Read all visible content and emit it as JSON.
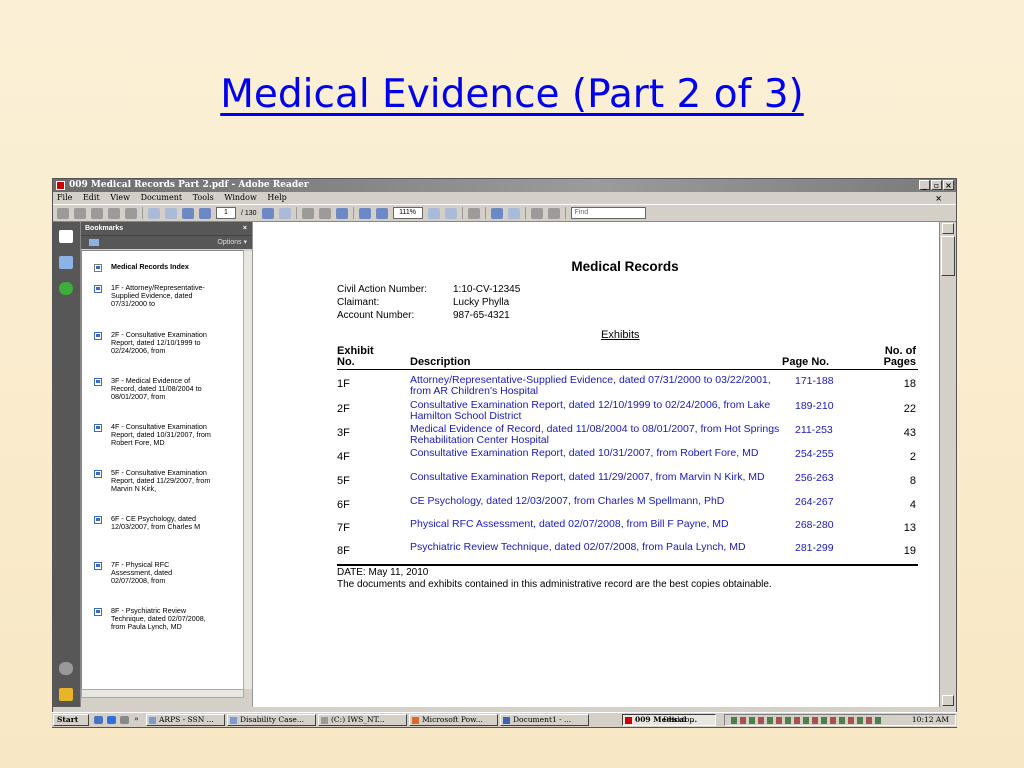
{
  "slide": {
    "title": "Medical Evidence (Part 2 of 3)"
  },
  "window": {
    "title": "009 Medical Records Part 2.pdf - Adobe Reader",
    "menu": [
      "File",
      "Edit",
      "View",
      "Document",
      "Tools",
      "Window",
      "Help"
    ],
    "close_glyph": "×",
    "toolbar": {
      "page_current": "1",
      "page_total": "/ 130",
      "zoom": "111%",
      "find_placeholder": "Find"
    }
  },
  "bookmarks": {
    "header": "Bookmarks",
    "close_glyph": "×",
    "options_label": "Options ▾",
    "items": [
      {
        "label": "Medical Records Index",
        "bold": true
      },
      {
        "label": "1F - Attorney/Representative-Supplied Evidence, dated 07/31/2000 to"
      },
      {
        "label": "2F - Consultative Examination Report, dated 12/10/1999 to 02/24/2006, from"
      },
      {
        "label": "3F - Medical Evidence of Record, dated 11/08/2004 to 08/01/2007, from"
      },
      {
        "label": "4F - Consultative Examination Report, dated 10/31/2007, from Robert Fore, MD"
      },
      {
        "label": "5F - Consultative Examination Report, dated 11/29/2007, from Marvin N Kirk,"
      },
      {
        "label": "6F - CE Psychology, dated 12/03/2007, from Charles M"
      },
      {
        "label": "7F - Physical RFC Assessment, dated 02/07/2008, from"
      },
      {
        "label": "8F - Psychiatric Review Technique, dated 02/07/2008, from Paula Lynch, MD"
      }
    ]
  },
  "document": {
    "title": "Medical Records",
    "meta": [
      {
        "label": "Civil Action Number:",
        "value": "1:10-CV-12345"
      },
      {
        "label": "Claimant:",
        "value": "Lucky Phylla"
      },
      {
        "label": "Account Number:",
        "value": "987-65-4321"
      }
    ],
    "exhibits_heading": "Exhibits",
    "columns": {
      "exhibit_no_1": "Exhibit",
      "exhibit_no_2": "No.",
      "description": "Description",
      "page_no": "Page No.",
      "num_pages_1": "No. of",
      "num_pages_2": "Pages"
    },
    "rows": [
      {
        "no": "1F",
        "desc": "Attorney/Representative-Supplied Evidence, dated 07/31/2000 to 03/22/2001, from AR Children's Hospital",
        "pages": "171-188",
        "count": "18"
      },
      {
        "no": "2F",
        "desc": "Consultative Examination Report, dated 12/10/1999 to 02/24/2006, from Lake Hamilton School District",
        "pages": "189-210",
        "count": "22"
      },
      {
        "no": "3F",
        "desc": "Medical Evidence of Record, dated 11/08/2004 to 08/01/2007, from Hot Springs Rehabilitation Center Hospital",
        "pages": "211-253",
        "count": "43"
      },
      {
        "no": "4F",
        "desc": "Consultative Examination Report, dated 10/31/2007, from Robert Fore, MD",
        "pages": "254-255",
        "count": "2"
      },
      {
        "no": "5F",
        "desc": "Consultative Examination Report, dated 11/29/2007, from Marvin N Kirk, MD",
        "pages": "256-263",
        "count": "8"
      },
      {
        "no": "6F",
        "desc": "CE Psychology, dated 12/03/2007, from Charles M Spellmann, PhD",
        "pages": "264-267",
        "count": "4"
      },
      {
        "no": "7F",
        "desc": "Physical RFC Assessment, dated 02/07/2008, from Bill F Payne, MD",
        "pages": "268-280",
        "count": "13"
      },
      {
        "no": "8F",
        "desc": "Psychiatric Review Technique, dated 02/07/2008, from Paula Lynch, MD",
        "pages": "281-299",
        "count": "19"
      }
    ],
    "date_line": "DATE: May 11, 2010",
    "note": "The documents and exhibits contained in this administrative record are the best copies obtainable."
  },
  "taskbar": {
    "start": "Start",
    "chevron": "»",
    "buttons": [
      "ARPS - SSN ...",
      "Disability Case...",
      "(C:) IWS_NT...",
      "Microsoft Pow...",
      "Document1 - ...",
      "009 Medical ..."
    ],
    "desktop": "Desktop",
    "clock": "10:12 AM"
  }
}
